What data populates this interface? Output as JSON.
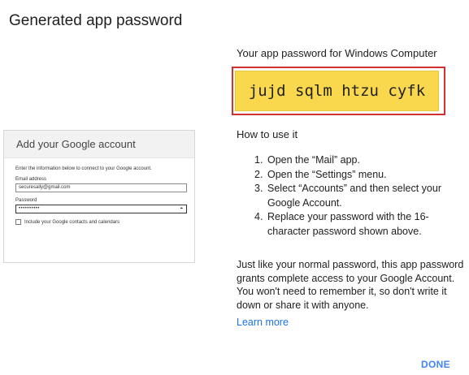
{
  "dialog": {
    "title": "Generated app password",
    "done_label": "DONE"
  },
  "mock_window": {
    "title": "Add your Google account",
    "intro": "Enter the information below to connect to your Google account.",
    "email_label": "Email address",
    "email_value": "securesally@gmail.com",
    "password_label": "Password",
    "password_value": "••••••••••",
    "checkbox_label": "Include your Google contacts and calendars"
  },
  "password_panel": {
    "heading": "Your app password for Windows Computer",
    "password": "jujd sqlm htzu cyfk"
  },
  "instructions": {
    "heading": "How to use it",
    "steps": [
      {
        "num": "1.",
        "text": "Open the “Mail” app."
      },
      {
        "num": "2.",
        "text": "Open the “Settings” menu."
      },
      {
        "num": "3.",
        "text": "Select “Accounts” and then select your Google Account."
      },
      {
        "num": "4.",
        "text": "Replace your password with the 16-character password shown above."
      }
    ],
    "paragraph": "Just like your normal password, this app password grants complete access to your Google Account. You won't need to remember it, so don't write it down or share it with anyone.",
    "learn_more": "Learn more"
  },
  "colors": {
    "password_bg": "#fad84e",
    "highlight_border": "#d32f2f",
    "link": "#1a73e8",
    "done": "#4285f4"
  },
  "icons": {
    "reveal_password": "eye-icon"
  }
}
